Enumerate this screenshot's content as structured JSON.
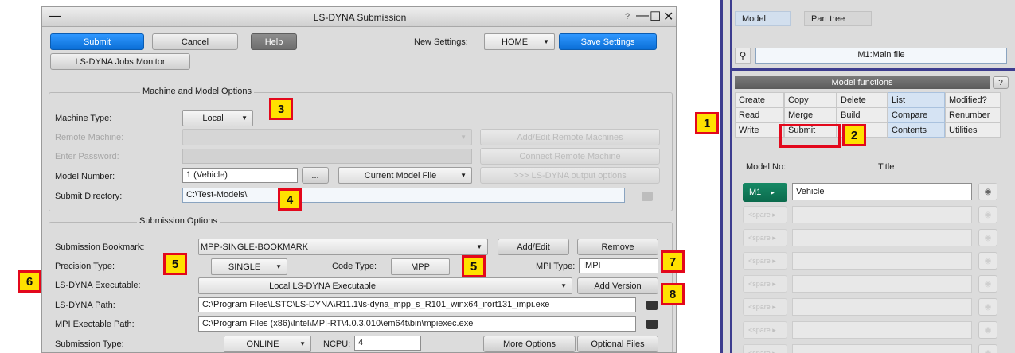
{
  "dialog": {
    "title": "LS-DYNA Submission",
    "title_dash": "—",
    "help_q": "?",
    "win_min": "—",
    "win_max": "☐",
    "win_close": "✕",
    "toolbar": {
      "submit": "Submit",
      "cancel": "Cancel",
      "help": "Help",
      "new_settings_label": "New Settings:",
      "new_settings_value": "HOME",
      "save_settings": "Save Settings",
      "jobs_monitor": "LS-DYNA Jobs Monitor"
    },
    "machine": {
      "section_title": "Machine and Model Options",
      "machine_type_label": "Machine Type:",
      "machine_type_value": "Local",
      "remote_machine_label": "Remote Machine:",
      "add_edit_remote": "Add/Edit Remote Machines",
      "enter_password_label": "Enter Password:",
      "connect_remote": "Connect Remote Machine",
      "model_number_label": "Model Number:",
      "model_number_value": "1 (Vehicle)",
      "ellipsis": "...",
      "model_file_value": "Current Model File",
      "output_options": ">>> LS-DYNA output options",
      "submit_dir_label": "Submit Directory:",
      "submit_dir_value": "C:\\Test-Models\\"
    },
    "submission": {
      "section_title": "Submission Options",
      "bookmark_label": "Submission Bookmark:",
      "bookmark_value": "MPP-SINGLE-BOOKMARK",
      "add_edit": "Add/Edit",
      "remove": "Remove",
      "precision_label": "Precision Type:",
      "precision_value": "SINGLE",
      "code_type_label": "Code Type:",
      "code_type_value": "MPP",
      "mpi_type_label": "MPI Type:",
      "mpi_type_value": "IMPI",
      "executable_label": "LS-DYNA Executable:",
      "executable_value": "Local LS-DYNA Executable",
      "add_version": "Add Version",
      "path_label": "LS-DYNA Path:",
      "path_value": "C:\\Program Files\\LSTC\\LS-DYNA\\R11.1\\ls-dyna_mpp_s_R101_winx64_ifort131_impi.exe",
      "mpi_path_label": "MPI Exectable Path:",
      "mpi_path_value": "C:\\Program Files (x86)\\Intel\\MPI-RT\\4.0.3.010\\em64t\\bin\\mpiexec.exe",
      "submission_type_label": "Submission Type:",
      "submission_type_value": "ONLINE",
      "ncpu_label": "NCPU:",
      "ncpu_value": "4",
      "more_options": "More Options",
      "optional_files": "Optional Files"
    }
  },
  "callouts": {
    "c1": "1",
    "c2": "2",
    "c3": "3",
    "c4": "4",
    "c5a": "5",
    "c5b": "5",
    "c6": "6",
    "c7": "7",
    "c8": "8"
  },
  "right_panel": {
    "tabs": {
      "model": "Model",
      "part_tree": "Part tree"
    },
    "search_value": "M1:Main file",
    "model_functions": {
      "title": "Model functions",
      "help": "?",
      "grid": [
        [
          "Create",
          "Copy",
          "Delete",
          "List",
          "Modified?"
        ],
        [
          "Read",
          "Merge",
          "Build",
          "Compare",
          "Renumber"
        ],
        [
          "Write",
          "Submit",
          "",
          "Contents",
          "Utilities"
        ]
      ]
    },
    "list": {
      "model_no_header": "Model No:",
      "title_header": "Title",
      "first_button": "M1",
      "first_arrow": "▸",
      "first_title": "Vehicle",
      "spare_label": "<spare ▸"
    }
  },
  "colors": {
    "accent_blue": "#0b6fd6",
    "callout_fill": "#ffe100",
    "callout_border": "#e3081c",
    "model_green": "#0b6a4c"
  }
}
